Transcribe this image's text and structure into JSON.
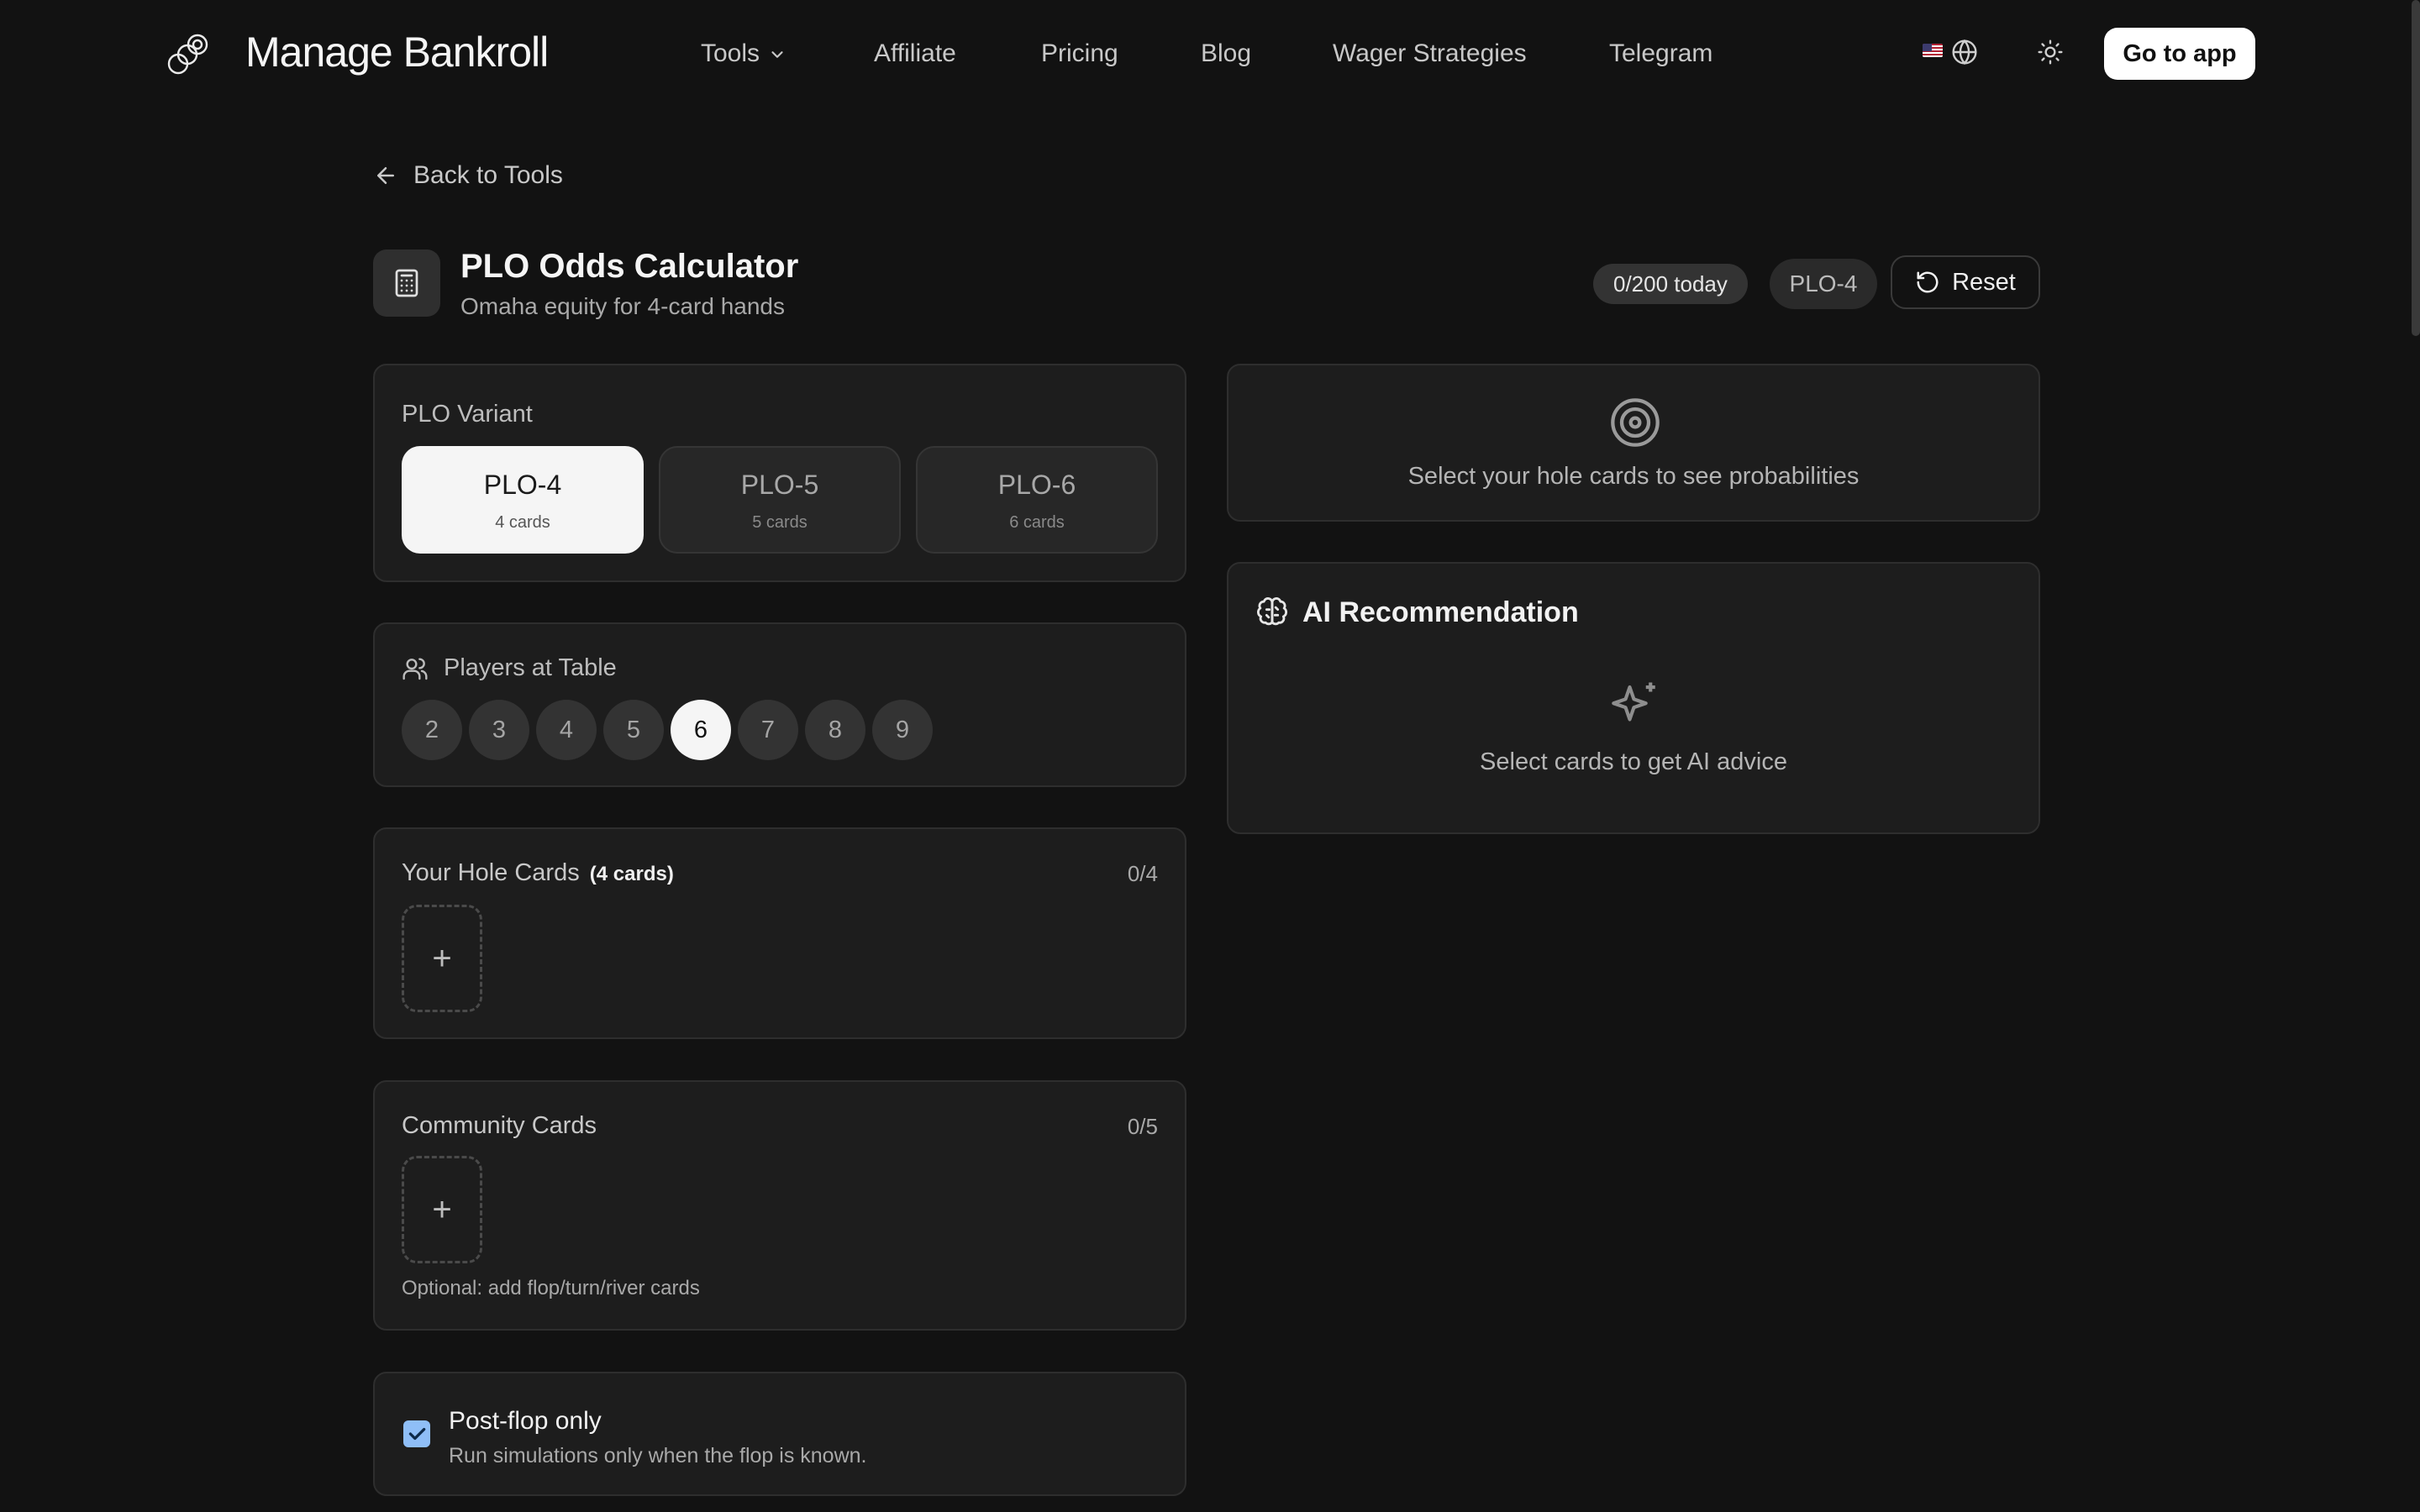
{
  "brand": {
    "name": "Manage Bankroll"
  },
  "nav": {
    "tools": "Tools",
    "affiliate": "Affiliate",
    "pricing": "Pricing",
    "blog": "Blog",
    "wager": "Wager Strategies",
    "telegram": "Telegram"
  },
  "header": {
    "cta": "Go to app"
  },
  "back_link": "Back to Tools",
  "page": {
    "title": "PLO Odds Calculator",
    "subtitle": "Omaha equity for 4-card hands",
    "usage_badge": "0/200 today",
    "variant_badge": "PLO-4",
    "reset_label": "Reset"
  },
  "variant": {
    "label": "PLO Variant",
    "options": [
      {
        "name": "PLO-4",
        "sub": "4 cards"
      },
      {
        "name": "PLO-5",
        "sub": "5 cards"
      },
      {
        "name": "PLO-6",
        "sub": "6 cards"
      }
    ],
    "selected": "PLO-4"
  },
  "players": {
    "label": "Players at Table",
    "options": [
      "2",
      "3",
      "4",
      "5",
      "6",
      "7",
      "8",
      "9"
    ],
    "selected": "6"
  },
  "hole_cards": {
    "label": "Your Hole Cards",
    "label_suffix": "(4 cards)",
    "count": "0/4",
    "add_symbol": "+"
  },
  "community_cards": {
    "label": "Community Cards",
    "count": "0/5",
    "add_symbol": "+",
    "hint": "Optional: add flop/turn/river cards"
  },
  "postflop": {
    "title": "Post-flop only",
    "subtitle": "Run simulations only when the flop is known.",
    "checked": true
  },
  "probabilities": {
    "empty_text": "Select your hole cards to see probabilities"
  },
  "ai": {
    "title": "AI Recommendation",
    "empty_text": "Select cards to get AI advice"
  },
  "colors": {
    "background": "#121212",
    "card": "#1d1d1d",
    "checkbox": "#8fbef7"
  }
}
